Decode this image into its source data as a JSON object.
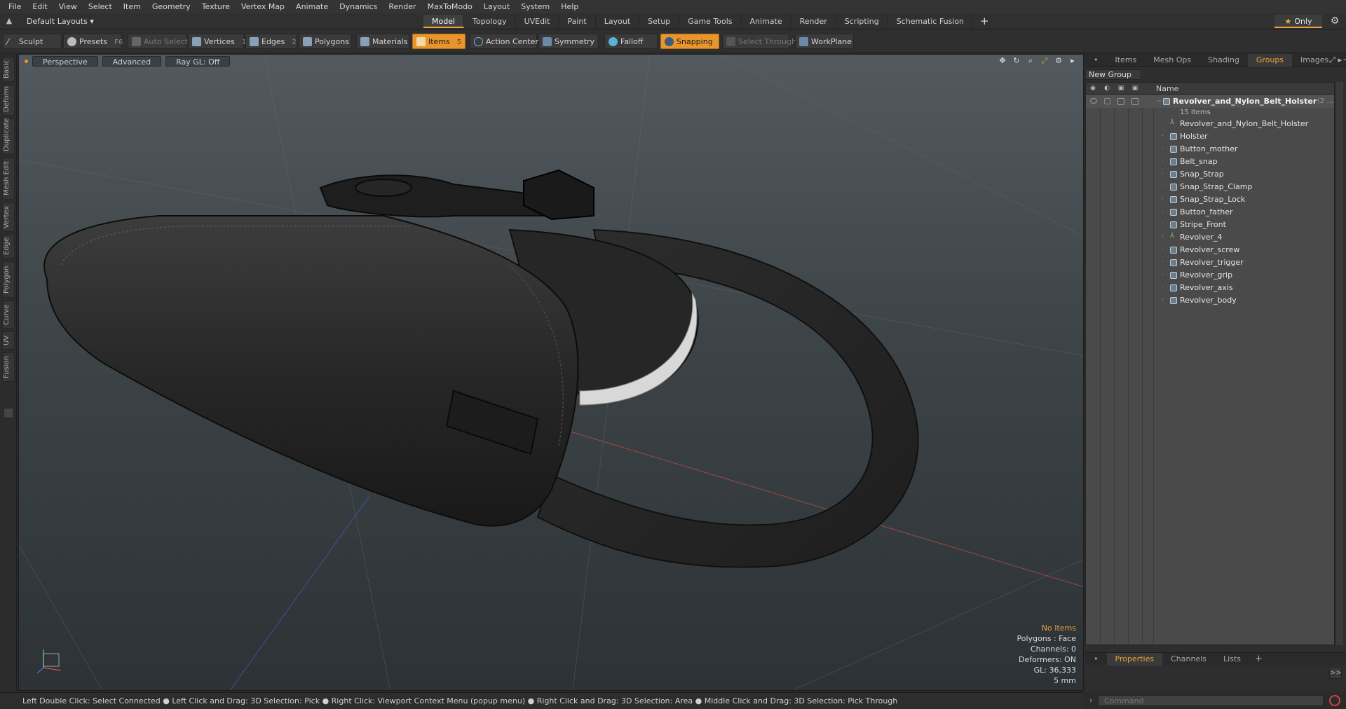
{
  "menubar": {
    "items": [
      "File",
      "Edit",
      "View",
      "Select",
      "Item",
      "Geometry",
      "Texture",
      "Vertex Map",
      "Animate",
      "Dynamics",
      "Render",
      "MaxToModo",
      "Layout",
      "System",
      "Help"
    ]
  },
  "layoutbar": {
    "layout_dropdown": "Default Layouts",
    "tabs": [
      "Model",
      "Topology",
      "UVEdit",
      "Paint",
      "Layout",
      "Setup",
      "Game Tools",
      "Animate",
      "Render",
      "Scripting",
      "Schematic Fusion"
    ],
    "active_tab": "Model",
    "add_label": "+",
    "only_label": "Only"
  },
  "toolbar": {
    "sculpt": "Sculpt",
    "presets": "Presets",
    "presets_key": "F6",
    "auto_select": "Auto Select",
    "vertices": "Vertices",
    "vertices_key": "1",
    "edges": "Edges",
    "edges_key": "2",
    "polygons": "Polygons",
    "materials": "Materials",
    "items": "Items",
    "items_key": "5",
    "action_center": "Action Center",
    "symmetry": "Symmetry",
    "falloff": "Falloff",
    "snapping": "Snapping",
    "select_through": "Select Through",
    "workplane": "WorkPlane"
  },
  "left_tabs": [
    "Basic",
    "Deform",
    "Duplicate",
    "Mesh Edit",
    "Vertex",
    "Edge",
    "Polygon",
    "Curve",
    "UV",
    "Fusion"
  ],
  "viewport": {
    "view_mode": "Perspective",
    "shading": "Advanced",
    "raygl": "Ray GL: Off",
    "info": {
      "selection": "No Items",
      "polygons": "Polygons : Face",
      "channels": "Channels: 0",
      "deformers": "Deformers: ON",
      "gl": "GL: 36,333",
      "units": "5 mm"
    }
  },
  "right_panel": {
    "tabs": [
      "Items",
      "Mesh Ops",
      "Shading",
      "Groups",
      "Images"
    ],
    "active_tab": "Groups",
    "new_group": "New Group",
    "column_name": "Name",
    "group_name": "Revolver_and_Nylon_Belt_Holster",
    "group_suffix": "(2 ...",
    "group_count": "15 Items",
    "items": [
      {
        "label": "Revolver_and_Nylon_Belt_Holster",
        "type": "locator"
      },
      {
        "label": "Holster",
        "type": "mesh"
      },
      {
        "label": "Button_mother",
        "type": "mesh"
      },
      {
        "label": "Belt_snap",
        "type": "mesh"
      },
      {
        "label": "Snap_Strap",
        "type": "mesh"
      },
      {
        "label": "Snap_Strap_Clamp",
        "type": "mesh"
      },
      {
        "label": "Snap_Strap_Lock",
        "type": "mesh"
      },
      {
        "label": "Button_father",
        "type": "mesh"
      },
      {
        "label": "Stripe_Front",
        "type": "mesh"
      },
      {
        "label": "Revolver_4",
        "type": "locator"
      },
      {
        "label": "Revolver_screw",
        "type": "mesh"
      },
      {
        "label": "Revolver_trigger",
        "type": "mesh"
      },
      {
        "label": "Revolver_grip",
        "type": "mesh"
      },
      {
        "label": "Revolver_axis",
        "type": "mesh"
      },
      {
        "label": "Revolver_body",
        "type": "mesh"
      }
    ],
    "bottom_tabs": [
      "Properties",
      "Channels",
      "Lists"
    ],
    "bottom_active": "Properties",
    "expand_label": ">>"
  },
  "command": {
    "placeholder": "Command"
  },
  "statusbar": {
    "text": "Left Double Click: Select Connected ● Left Click and Drag: 3D Selection: Pick ● Right Click: Viewport Context Menu (popup menu) ● Right Click and Drag: 3D Selection: Area ● Middle Click and Drag: 3D Selection: Pick Through"
  },
  "colors": {
    "accent": "#e8952e",
    "active_tab_text": "#e8a33a",
    "viewport_top": "#525a5f",
    "viewport_bottom": "#2c3236"
  }
}
